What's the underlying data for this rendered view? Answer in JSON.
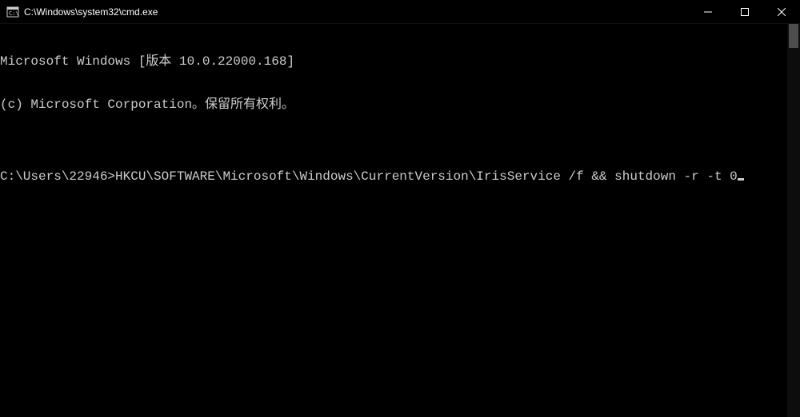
{
  "titlebar": {
    "title": "C:\\Windows\\system32\\cmd.exe"
  },
  "terminal": {
    "line1": "Microsoft Windows [版本 10.0.22000.168]",
    "line2": "(c) Microsoft Corporation。保留所有权利。",
    "blank1": "",
    "prompt": "C:\\Users\\22946>",
    "command": "HKCU\\SOFTWARE\\Microsoft\\Windows\\CurrentVersion\\IrisService /f && shutdown -r -t 0"
  }
}
